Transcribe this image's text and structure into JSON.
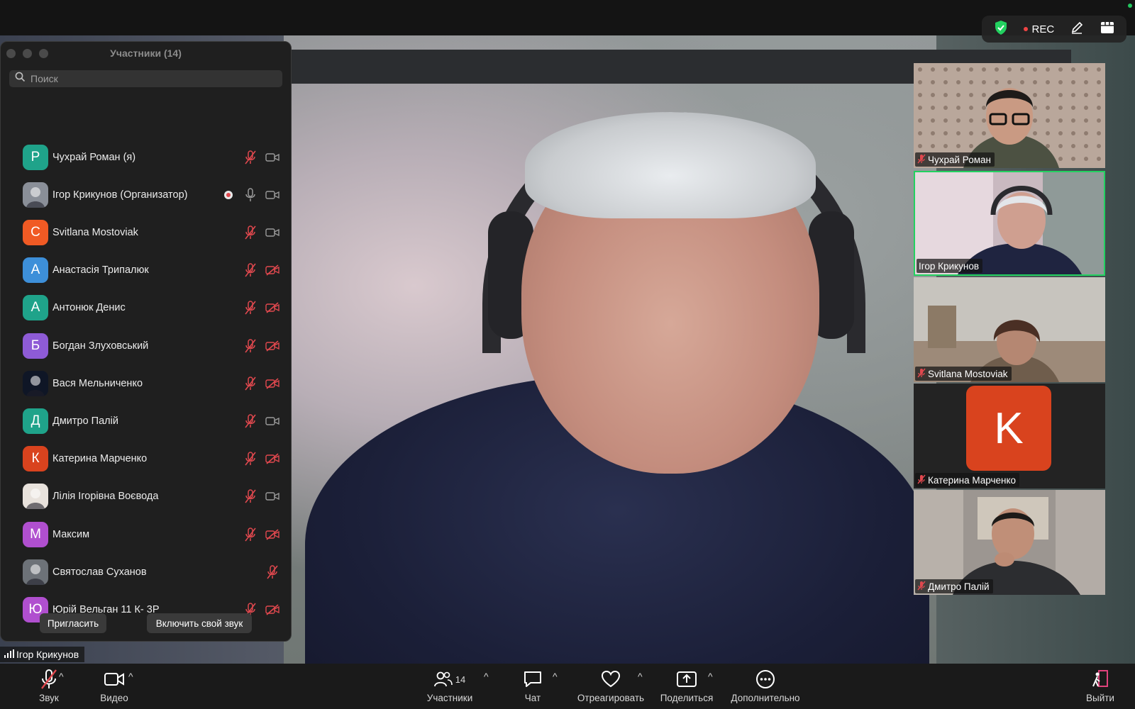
{
  "top_bar": {
    "rec_label": "REC"
  },
  "participants_panel": {
    "title": "Участники (14)",
    "search_placeholder": "Поиск",
    "participants": [
      {
        "initial": "Р",
        "name": "Чухрай Роман (я)",
        "avatar_color": "#1fa38a",
        "mic": "muted",
        "camera": "on"
      },
      {
        "initial": "",
        "name": "Ігор Крикунов (Организатор)",
        "avatar_color": "#8a8f98",
        "mic": "on",
        "camera": "on",
        "recording": true
      },
      {
        "initial": "С",
        "name": "Svitlana Mostoviak",
        "avatar_color": "#f05a24",
        "mic": "muted",
        "camera": "on"
      },
      {
        "initial": "А",
        "name": "Анастасія Трипалюк",
        "avatar_color": "#3d8fd9",
        "mic": "muted",
        "camera": "off"
      },
      {
        "initial": "А",
        "name": "Антонюк Денис",
        "avatar_color": "#1fa38a",
        "mic": "muted",
        "camera": "off"
      },
      {
        "initial": "Б",
        "name": "Богдан Злуховський",
        "avatar_color": "#8e5bd6",
        "mic": "muted",
        "camera": "off"
      },
      {
        "initial": "",
        "name": "Вася Мельниченко",
        "avatar_color": "#0f1626",
        "mic": "muted",
        "camera": "off"
      },
      {
        "initial": "Д",
        "name": "Дмитро Палій",
        "avatar_color": "#1fa38a",
        "mic": "muted",
        "camera": "on"
      },
      {
        "initial": "К",
        "name": "Катерина Марченко",
        "avatar_color": "#d9431e",
        "mic": "muted",
        "camera": "off"
      },
      {
        "initial": "",
        "name": "Лілія Ігорівна Воєвода",
        "avatar_color": "#e8e2dc",
        "mic": "muted",
        "camera": "on"
      },
      {
        "initial": "М",
        "name": "Максим",
        "avatar_color": "#b04fcf",
        "mic": "muted",
        "camera": "off"
      },
      {
        "initial": "",
        "name": "Святослав Суханов",
        "avatar_color": "#6d7278",
        "mic": "muted",
        "camera": "none"
      },
      {
        "initial": "Ю",
        "name": "Юрій Вельган 11 К- 3Р",
        "avatar_color": "#b04fcf",
        "mic": "muted",
        "camera": "off"
      }
    ],
    "invite_label": "Пригласить",
    "unmute_label": "Включить свой звук"
  },
  "active_speaker_label": "Ігор Крикунов",
  "thumbnails": [
    {
      "name": "Чухрай Роман",
      "muted": true,
      "active": false
    },
    {
      "name": "Ігор Крикунов",
      "muted": false,
      "active": true
    },
    {
      "name": "Svitlana Mostoviak",
      "muted": true,
      "active": false
    },
    {
      "name": "Катерина Марченко",
      "muted": true,
      "active": false,
      "initial": "K",
      "avatar_color": "#d9431e"
    },
    {
      "name": "Дмитро Палій",
      "muted": true,
      "active": false
    }
  ],
  "toolbar": {
    "audio_label": "Звук",
    "video_label": "Видео",
    "participants_label": "Участники",
    "participants_count": "14",
    "chat_label": "Чат",
    "react_label": "Отреагировать",
    "share_label": "Поделиться",
    "more_label": "Дополнительно",
    "leave_label": "Выйти"
  },
  "colors": {
    "accent_green": "#23d160",
    "muted_red": "#e0484e",
    "rec_red": "#ef4444",
    "leave_pink": "#e0437c"
  }
}
